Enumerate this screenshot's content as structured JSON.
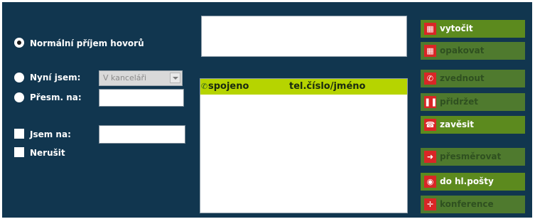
{
  "options": {
    "receive_label": "Normální příjem hovorů",
    "now_label": "Nyní jsem:",
    "now_value": "V kanceláři",
    "forward_label": "Přesm. na:",
    "forward_value": "",
    "iam_label": "Jsem na:",
    "iam_value": "",
    "dnd_label": "Nerušit"
  },
  "list": {
    "col_connected": "spojeno",
    "col_number": "tel.číslo/jméno"
  },
  "actions": {
    "dial": "vytočit",
    "redial": "opakovat",
    "answer": "zvednout",
    "hold": "přidržet",
    "hangup": "zavěsit",
    "forward": "přesměrovat",
    "voicemail": "do hl.pošty",
    "conference": "konference"
  },
  "icons": {
    "dial": "keypad-icon",
    "redial": "keypad-icon",
    "answer": "phone-handset-icon",
    "hold": "pause-icon",
    "hangup": "hangup-icon",
    "forward": "arrow-right-icon",
    "voicemail": "voicemail-icon",
    "conference": "conference-icon"
  },
  "colors": {
    "panel_bg": "#11364f",
    "list_header": "#b6d400",
    "button_bg": "#4f7a2e",
    "button_active": "#5c8a1e",
    "icon_red": "#d92626"
  }
}
